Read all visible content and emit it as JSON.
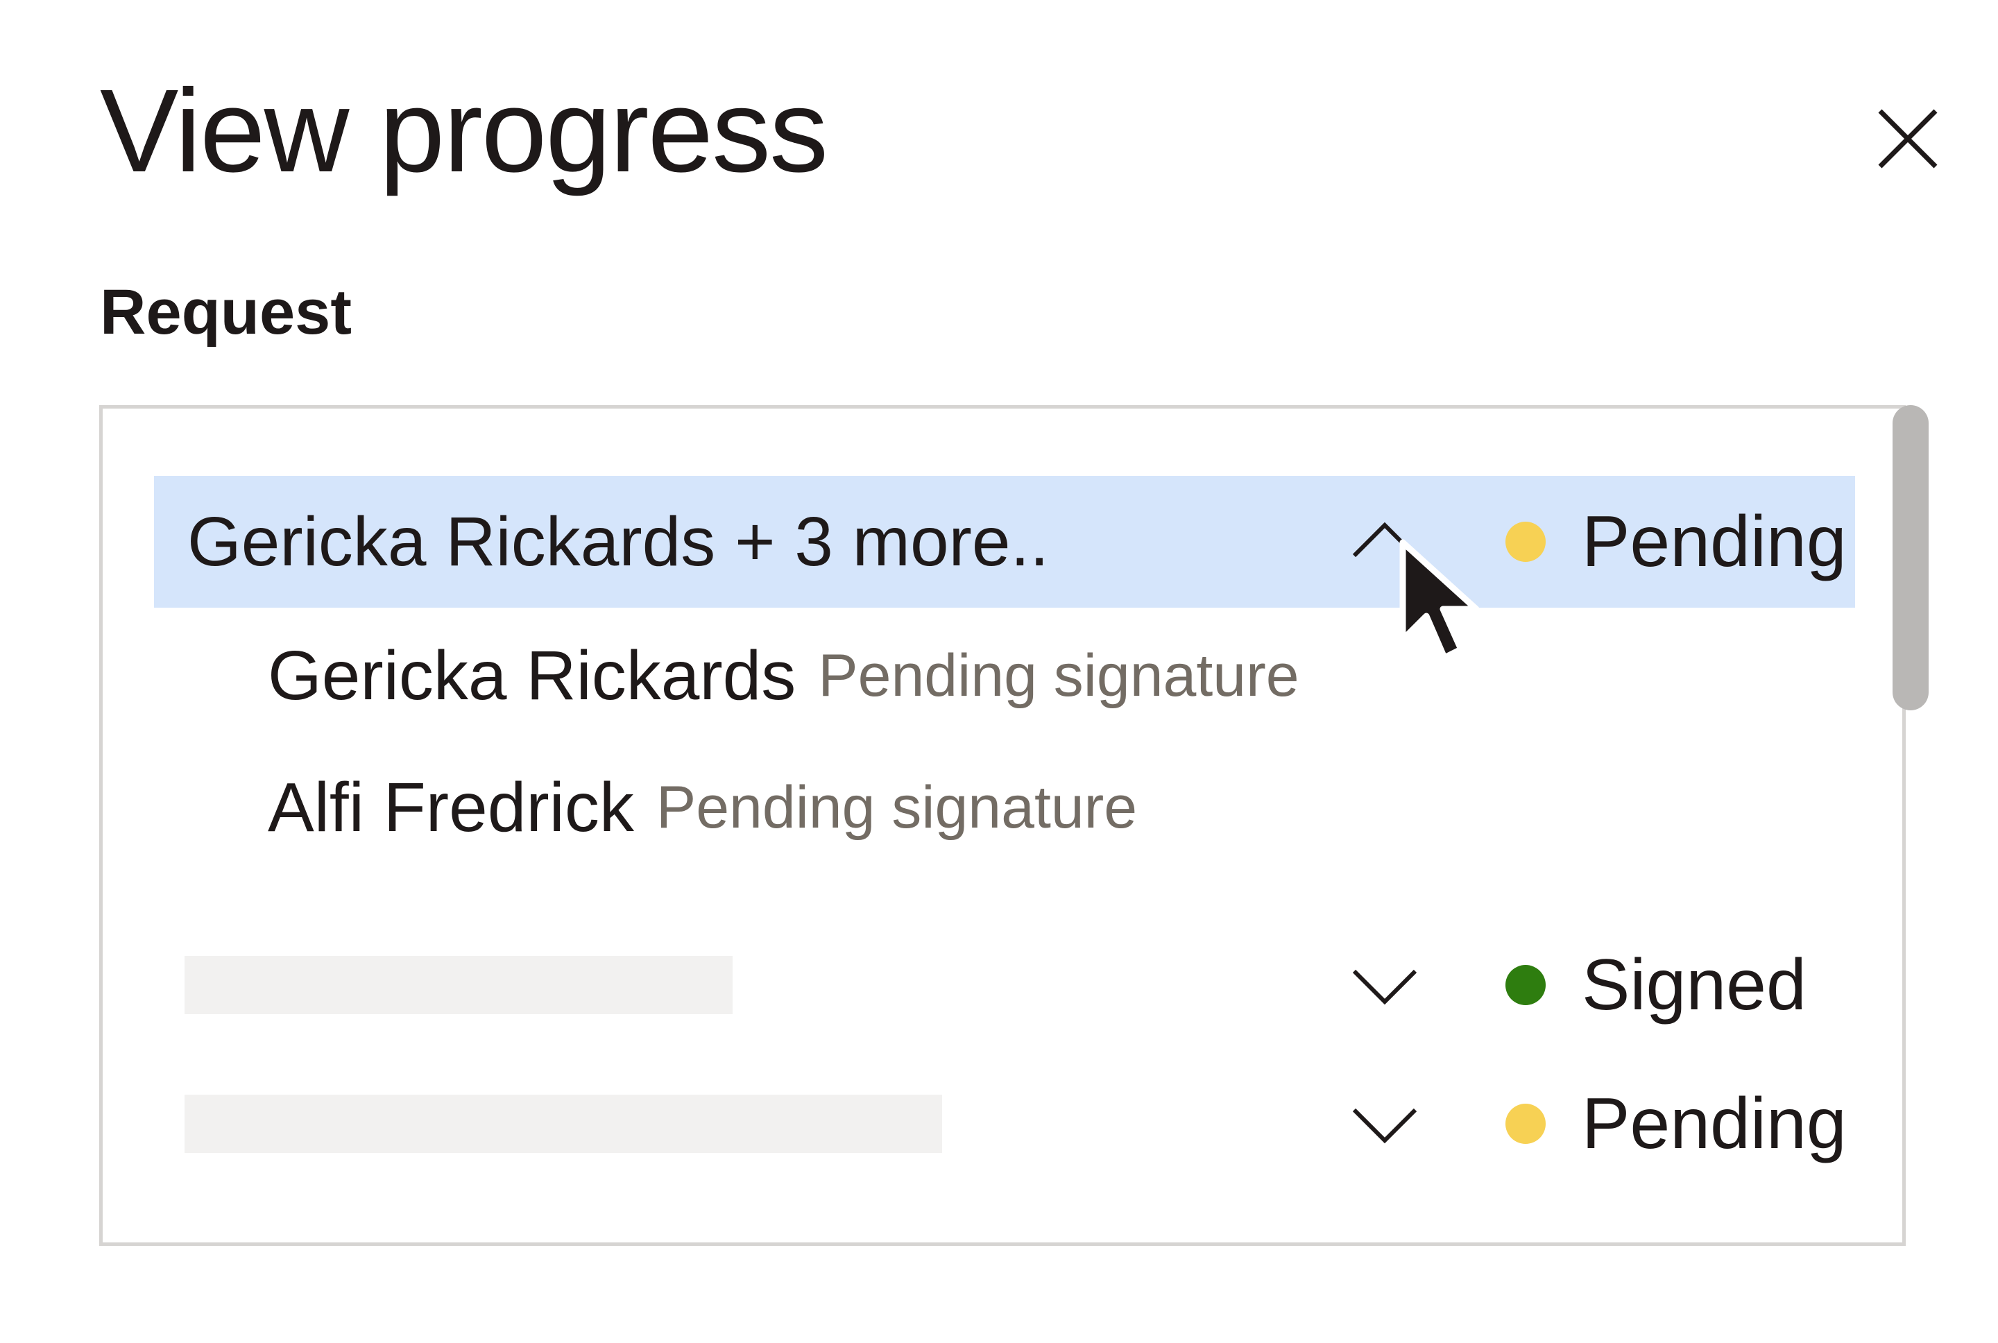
{
  "dialog": {
    "title": "View progress",
    "close_icon": "close-icon"
  },
  "request": {
    "label": "Request",
    "rows": [
      {
        "title": "Gericka Rickards + 3 more..",
        "expanded": true,
        "chevron_icon": "chevron-up-icon",
        "status": "Pending",
        "status_color": "#f7d154",
        "signers": [
          {
            "name": "Gericka Rickards",
            "status": "Pending signature"
          },
          {
            "name": "Alfi Fredrick",
            "status": "Pending signature"
          }
        ]
      },
      {
        "title": "",
        "expanded": false,
        "chevron_icon": "chevron-down-icon",
        "status": "Signed",
        "status_color": "#2e7d0f"
      },
      {
        "title": "",
        "expanded": false,
        "chevron_icon": "chevron-down-icon",
        "status": "Pending",
        "status_color": "#f7d154"
      }
    ]
  },
  "colors": {
    "selected_row": "#d5e5fb",
    "pending": "#f7d154",
    "signed": "#2e7d0f",
    "muted_text": "#736c64"
  },
  "cursor_icon": "mouse-pointer-icon"
}
